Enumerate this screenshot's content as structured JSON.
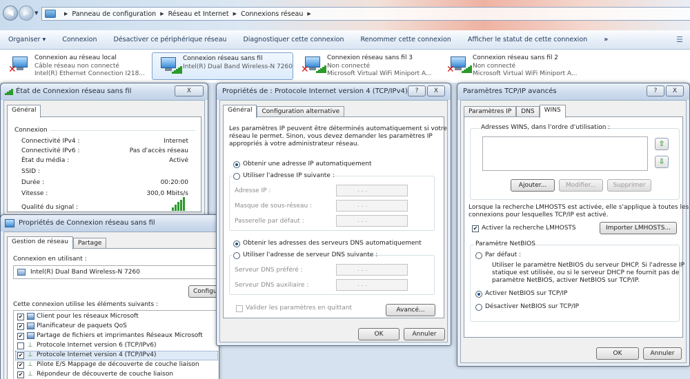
{
  "breadcrumb": [
    "Panneau de configuration",
    "Réseau et Internet",
    "Connexions réseau"
  ],
  "toolbar": {
    "organize": "Organiser ▾",
    "items": [
      "Connexion",
      "Désactiver ce périphérique réseau",
      "Diagnostiquer cette connexion",
      "Renommer cette connexion",
      "Afficher le statut de cette connexion"
    ],
    "more": "»"
  },
  "connections": [
    {
      "name": "Connexion au réseau local",
      "status": "Câble réseau non connecté",
      "device": "Intel(R) Ethernet Connection I218...",
      "icon": "ethernet-disconnected-icon"
    },
    {
      "name": "Connexion réseau sans fil",
      "status": "",
      "device": "Intel(R) Dual Band Wireless-N 7260",
      "icon": "wifi-connected-icon"
    },
    {
      "name": "Connexion réseau sans fil 3",
      "status": "Non connecté",
      "device": "Microsoft Virtual WiFi Miniport A...",
      "icon": "wifi-disconnected-icon"
    },
    {
      "name": "Connexion réseau sans fil 2",
      "status": "Non connecté",
      "device": "Microsoft Virtual WiFi Miniport A...",
      "icon": "wifi-disconnected-icon"
    }
  ],
  "status_window": {
    "title": "État de Connexion réseau sans fil",
    "close": "X",
    "tab": "Général",
    "group": "Connexion",
    "rows": [
      {
        "label": "Connectivité IPv4 :",
        "value": "Internet"
      },
      {
        "label": "Connectivité IPv6 :",
        "value": "Pas d'accès réseau"
      },
      {
        "label": "État du média :",
        "value": "Activé"
      },
      {
        "label": "SSID :",
        "value": ""
      },
      {
        "label": "Durée :",
        "value": "00:20:00"
      },
      {
        "label": "Vitesse :",
        "value": "300,0 Mbits/s"
      }
    ],
    "signal_label": "Qualité du signal :",
    "signal_level": 5
  },
  "props_window": {
    "title": "Propriétés de Connexion réseau sans fil",
    "tabs": [
      "Gestion de réseau",
      "Partage"
    ],
    "connect_using_label": "Connexion en utilisant :",
    "adapter": "Intel(R) Dual Band Wireless-N 7260",
    "configure": "Configurer...",
    "items_label": "Cette connexion utilise les éléments suivants :",
    "items": [
      {
        "label": "Client pour les réseaux Microsoft",
        "checked": true
      },
      {
        "label": "Planificateur de paquets QoS",
        "checked": true
      },
      {
        "label": "Partage de fichiers et imprimantes Réseaux Microsoft",
        "checked": true
      },
      {
        "label": "Protocole Internet version 6 (TCP/IPv6)",
        "checked": false
      },
      {
        "label": "Protocole Internet version 4 (TCP/IPv4)",
        "checked": true
      },
      {
        "label": "Pilote E/S Mappage de découverte de couche liaison",
        "checked": true
      },
      {
        "label": "Répondeur de découverte de couche liaison",
        "checked": true
      }
    ]
  },
  "ipv4_window": {
    "title": "Propriétés de : Protocole Internet version 4 (TCP/IPv4)",
    "help": "?",
    "close": "X",
    "tabs": [
      "Général",
      "Configuration alternative"
    ],
    "description": [
      "Les paramètres IP peuvent être déterminés automatiquement si votre",
      "réseau le permet. Sinon, vous devez demander les paramètres IP",
      "appropriés à votre administrateur réseau."
    ],
    "auto_ip": "Obtenir une adresse IP automatiquement",
    "manual_ip": "Utiliser l'adresse IP suivante :",
    "ip_fields": [
      "Adresse IP :",
      "Masque de sous-réseau :",
      "Passerelle par défaut :"
    ],
    "auto_dns": "Obtenir les adresses des serveurs DNS automatiquement",
    "manual_dns": "Utiliser l'adresse de serveur DNS suivante :",
    "dns_fields": [
      "Serveur DNS préféré :",
      "Serveur DNS auxiliaire :"
    ],
    "ip_dots": ". . .",
    "validate": "Valider les paramètres en quittant",
    "advanced": "Avancé...",
    "ok": "OK",
    "cancel": "Annuler"
  },
  "tcpip_window": {
    "title": "Paramètres TCP/IP avancés",
    "help": "?",
    "close": "X",
    "tabs": [
      "Paramètres IP",
      "DNS",
      "WINS"
    ],
    "wins_label": "Adresses WINS, dans l'ordre d'utilisation :",
    "add": "Ajouter...",
    "modify": "Modifier...",
    "delete": "Supprimer",
    "lmhosts_text": [
      "Lorsque la recherche LMHOSTS est activée, elle s'applique à toutes les",
      "connexions pour lesquelles TCP/IP est activé."
    ],
    "lmhosts_check": "Activer la recherche LMHOSTS",
    "import": "Importer LMHOSTS...",
    "netbios_group": "Paramètre NetBIOS",
    "default": "Par défaut :",
    "default_desc": [
      "Utiliser le paramètre NetBIOS du serveur DHCP. Si l'adresse IP",
      "statique est utilisée, ou si le serveur DHCP ne fournit pas de",
      "paramètre NetBIOS, activer NetBIOS sur TCP/IP."
    ],
    "enable": "Activer NetBIOS sur TCP/IP",
    "disable": "Désactiver NetBIOS sur TCP/IP",
    "ok": "OK",
    "cancel": "Annuler"
  }
}
